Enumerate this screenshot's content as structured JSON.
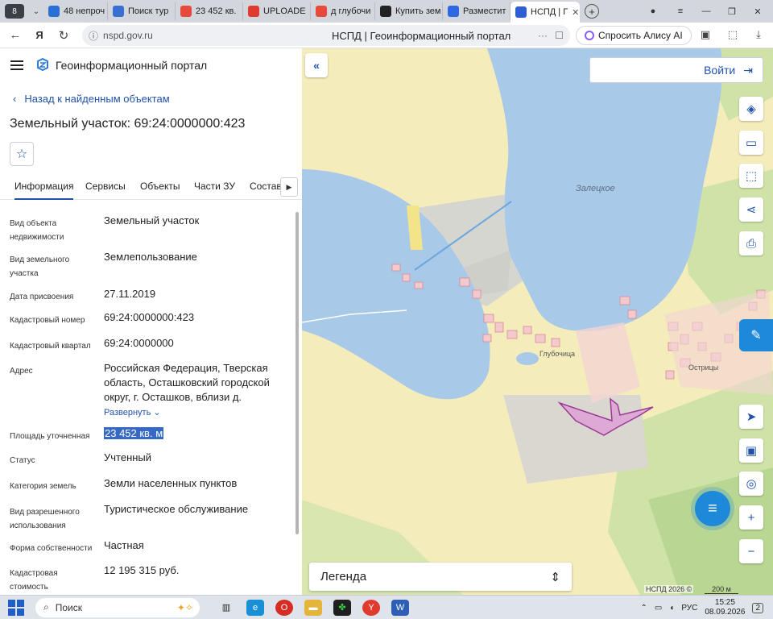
{
  "browser": {
    "profile_badge": "8",
    "tabs": [
      {
        "label": "48 непроч",
        "color": "#2a6fd6"
      },
      {
        "label": "Поиск тур",
        "color": "#3a6fd1"
      },
      {
        "label": "23 452 кв.",
        "color": "#e64a3c"
      },
      {
        "label": "UPLOADE",
        "color": "#e03b2f"
      },
      {
        "label": "д глубочи",
        "color": "#e64a3c"
      },
      {
        "label": "Купить зем",
        "color": "#222222"
      },
      {
        "label": "Разместит",
        "color": "#2d6ae0"
      },
      {
        "label": "НСПД | Г",
        "color": "#2f5fd0"
      }
    ],
    "url": "nspd.gov.ru",
    "page_title": "НСПД | Геоинформационный портал",
    "alice_label": "Спросить Алису AI"
  },
  "portal": {
    "title": "Геоинформационный портал",
    "back_link": "Назад к найденным объектам",
    "heading": "Земельный участок: 69:24:0000000:423",
    "tabs": [
      "Информация",
      "Сервисы",
      "Объекты",
      "Части ЗУ",
      "Состав"
    ],
    "info": [
      {
        "label": "Вид объекта недвижимости",
        "value": "Земельный участок"
      },
      {
        "label": "Вид земельного участка",
        "value": "Землепользование"
      },
      {
        "label": "Дата присвоения",
        "value": "27.11.2019"
      },
      {
        "label": "Кадастровый номер",
        "value": "69:24:0000000:423"
      },
      {
        "label": "Кадастровый квартал",
        "value": "69:24:0000000"
      },
      {
        "label": "Адрес",
        "value": "Российская Федерация, Тверская область, Осташковский городской округ, г. Осташков, вблизи д.",
        "expand": "Развернуть"
      },
      {
        "label": "Площадь уточненная",
        "value": "23 452 кв. м"
      },
      {
        "label": "Статус",
        "value": "Учтенный"
      },
      {
        "label": "Категория земель",
        "value": "Земли населенных пунктов"
      },
      {
        "label": "Вид разрешенного использования",
        "value": "Туристическое обслуживание"
      },
      {
        "label": "Форма собственности",
        "value": "Частная"
      },
      {
        "label": "Кадастровая стоимость",
        "value": "12 195 315 руб."
      }
    ]
  },
  "map": {
    "login_label": "Войти",
    "lake_label": "Залецкое",
    "village_1": "Глубочица",
    "village_2": "Острицы",
    "legend_label": "Легенда",
    "copyright": "НСПД 2026 ©",
    "scale": "200 м"
  },
  "taskbar": {
    "search_placeholder": "Поиск",
    "language": "РУС",
    "time": "15:25",
    "date": "08.09.2026",
    "notifications": "2"
  }
}
